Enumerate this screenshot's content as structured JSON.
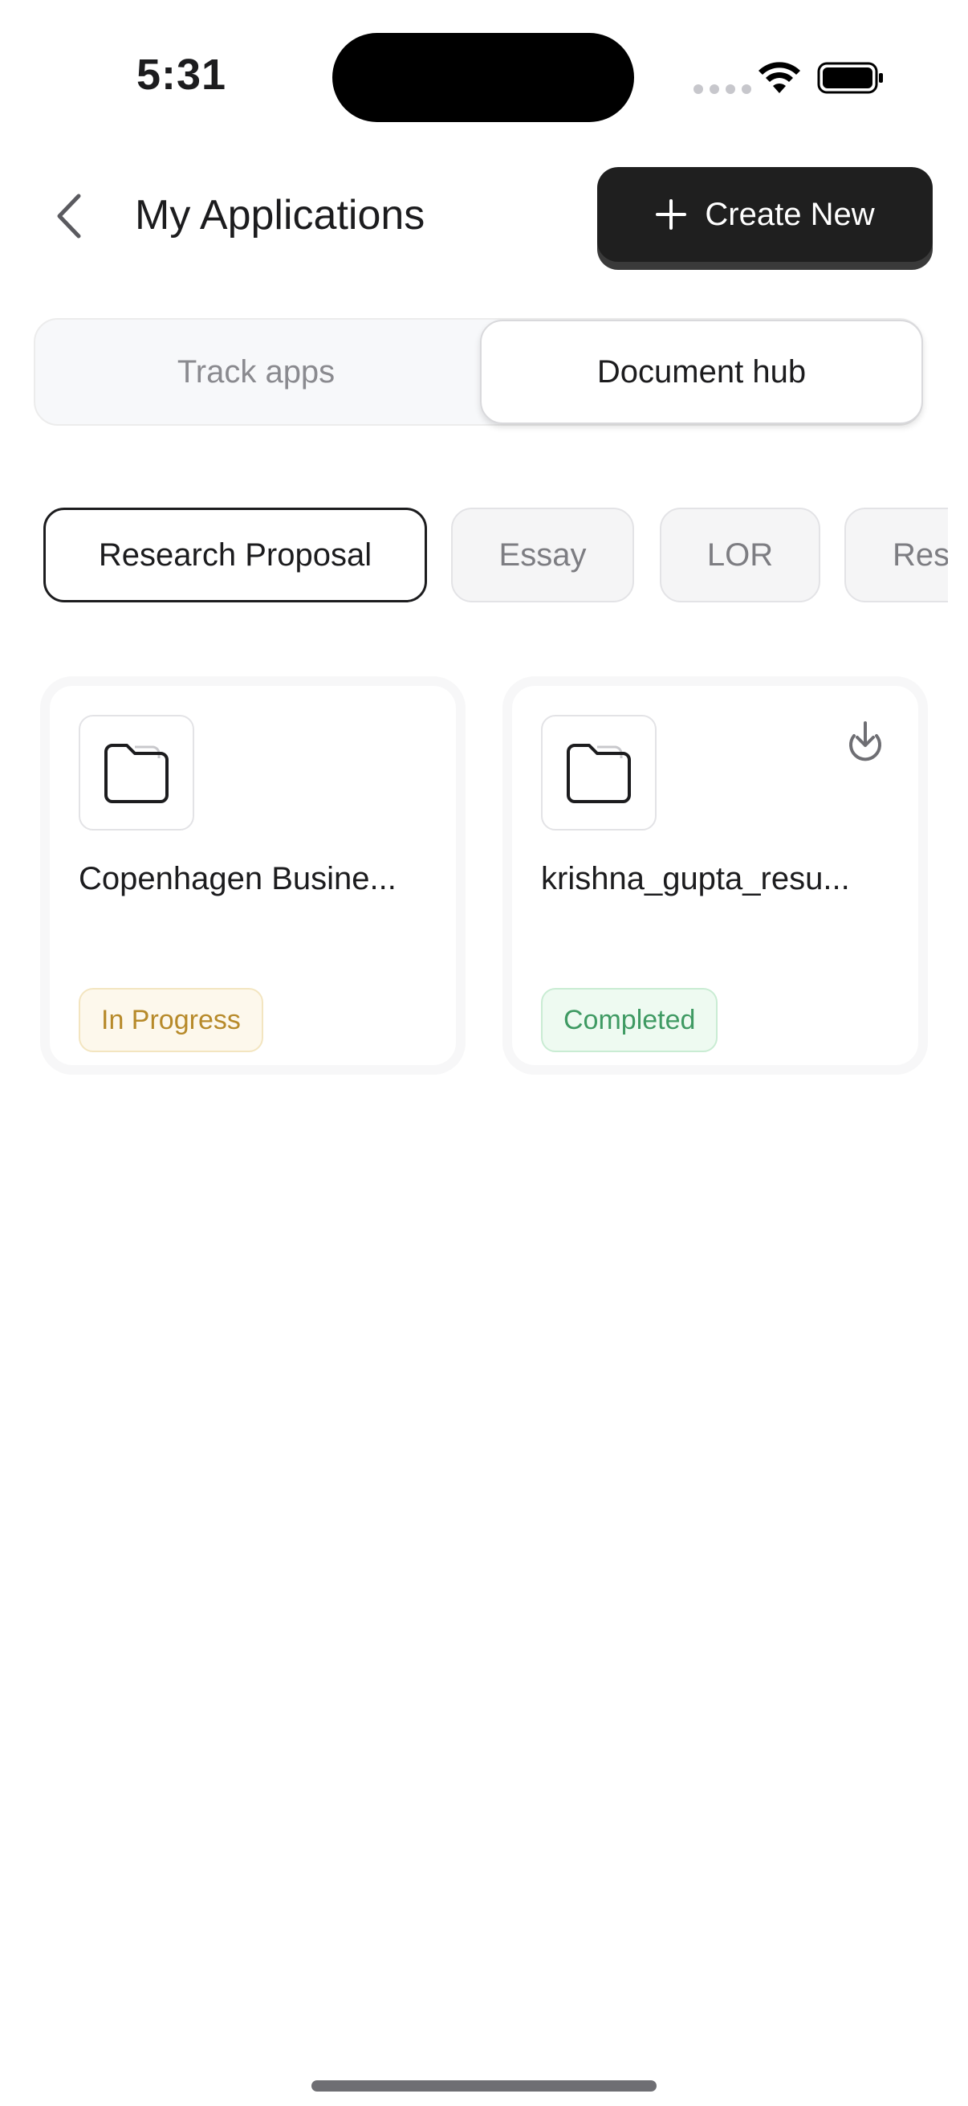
{
  "status_bar": {
    "time": "5:31"
  },
  "header": {
    "title": "My Applications",
    "create_label": "Create New"
  },
  "tabs": [
    {
      "label": "Track apps",
      "active": false
    },
    {
      "label": "Document hub",
      "active": true
    }
  ],
  "chips": [
    {
      "label": "Research Proposal",
      "selected": true
    },
    {
      "label": "Essay",
      "selected": false
    },
    {
      "label": "LOR",
      "selected": false
    },
    {
      "label": "Res",
      "selected": false
    }
  ],
  "documents": [
    {
      "name": "Copenhagen Busine...",
      "status": "In Progress",
      "status_color": "#b78a2a",
      "downloadable": false
    },
    {
      "name": "krishna_gupta_resu...",
      "status": "Completed",
      "status_color": "#3f9a63",
      "downloadable": true
    }
  ],
  "icons": {
    "back": "chevron-left-icon",
    "create": "plus-icon",
    "folder": "folder-icon",
    "download": "download-icon",
    "wifi": "wifi-icon",
    "battery": "battery-icon"
  },
  "colors": {
    "primary_button": "#1f1f1f",
    "in_progress": "#b78a2a",
    "completed": "#3f9a63"
  }
}
